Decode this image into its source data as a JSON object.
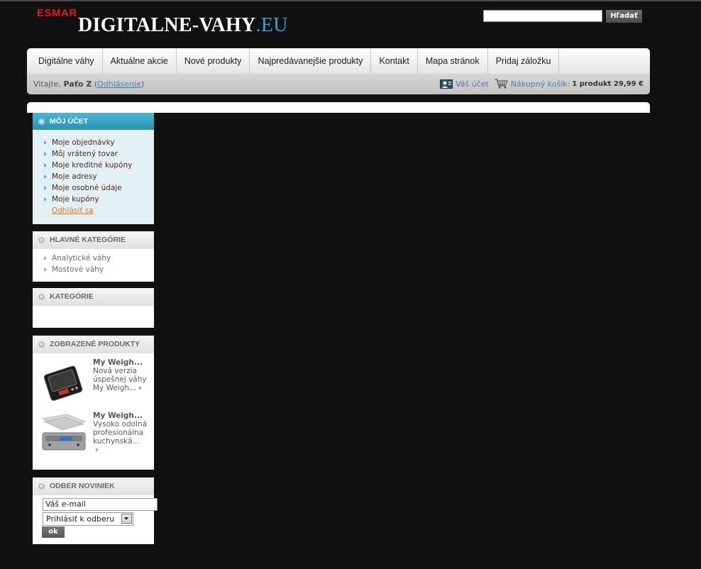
{
  "logo": {
    "brand": "ESMAR",
    "name": "DIGITALNE-VAHY",
    "tld": ".EU"
  },
  "search": {
    "value": "",
    "button_label": "Hľadať"
  },
  "nav": {
    "items": [
      {
        "label": "Digitálne váhy"
      },
      {
        "label": "Aktuálne akcie"
      },
      {
        "label": "Nové produkty"
      },
      {
        "label": "Najpredávanejšie produkty"
      },
      {
        "label": "Kontakt"
      },
      {
        "label": "Mapa stránok"
      },
      {
        "label": "Pridaj záložku"
      }
    ]
  },
  "userbar": {
    "welcome": "Vitajte,",
    "user_name": "Paťo Z",
    "logout_prefix": "(",
    "logout_label": "Odhlásenie",
    "logout_suffix": ")",
    "account_label": "Váš účet",
    "cart_label": "Nákupný košík:",
    "cart_summary": "1 produkt 29,99 €"
  },
  "account_box": {
    "title": "MÔJ ÚČET",
    "links": [
      {
        "label": "Moje objednávky"
      },
      {
        "label": "Môj vrátený tovar"
      },
      {
        "label": "Moje kreditné kupóny"
      },
      {
        "label": "Moje adresy"
      },
      {
        "label": "Moje osobné údaje"
      },
      {
        "label": "Moje kupóny"
      }
    ],
    "logout_label": "Odhlásiť sa"
  },
  "main_categories": {
    "title": "HLAVNÉ KATEGÓRIE",
    "items": [
      {
        "label": "Analytické váhy"
      },
      {
        "label": "Mostové váhy"
      }
    ]
  },
  "categories": {
    "title": "KATEGÓRIE"
  },
  "viewed_products": {
    "title": "ZOBRAZENÉ PRODUKTY",
    "items": [
      {
        "title": "My Weigh...",
        "description": "Nová verzia úspešnej váhy My Weigh..."
      },
      {
        "title": "My Weigh...",
        "description": "Vysoko odolná profesionálna kuchynská..."
      }
    ]
  },
  "newsletter": {
    "title": "ODBER NOVINIEK",
    "email_value": "Váš e-mail",
    "select_value": "Prihlásiť k odberu",
    "ok_label": "ok"
  },
  "colors": {
    "background": "#111111",
    "accent_blue": "#2b90b3",
    "logo_red": "#e3171b",
    "logout_orange": "#e2781c"
  }
}
